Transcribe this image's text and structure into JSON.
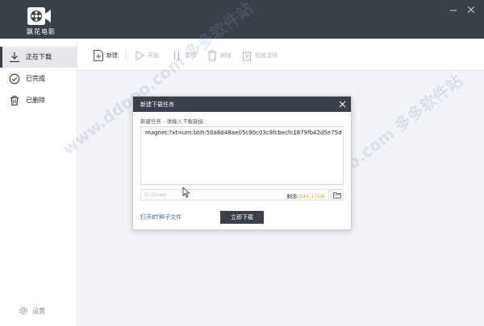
{
  "app": {
    "logo_text": "飘花电影"
  },
  "sidebar": {
    "items": [
      {
        "label": "正在下载",
        "icon": "download-icon",
        "active": true
      },
      {
        "label": "已完成",
        "icon": "check-circle-icon",
        "active": false
      },
      {
        "label": "已删除",
        "icon": "trash-icon",
        "active": false
      }
    ],
    "settings_label": "设置"
  },
  "toolbar": {
    "new": "新建",
    "start": "开始",
    "pause": "暂停",
    "delete": "删除",
    "clear_all": "彻底清除"
  },
  "dialog": {
    "title": "新建下载任务",
    "subtitle": "新建任务 - 请输入下载链接:",
    "magnet_value": "magnet:?xt=urn:btih:50a6d48ae05c90c03c9fcbecfc1879fb42d5e75d",
    "path_placeholder": "D:\\Down",
    "free_label": "剩余:",
    "free_value": "546.17GB",
    "bt_link": "打开BT种子文件",
    "download_button": "立即下载"
  },
  "watermark": "www.ddooo.com 多多软件站",
  "colors": {
    "titlebar": "#3a4049",
    "accent_link": "#2a6bb3",
    "free_space": "#e8a33b"
  }
}
